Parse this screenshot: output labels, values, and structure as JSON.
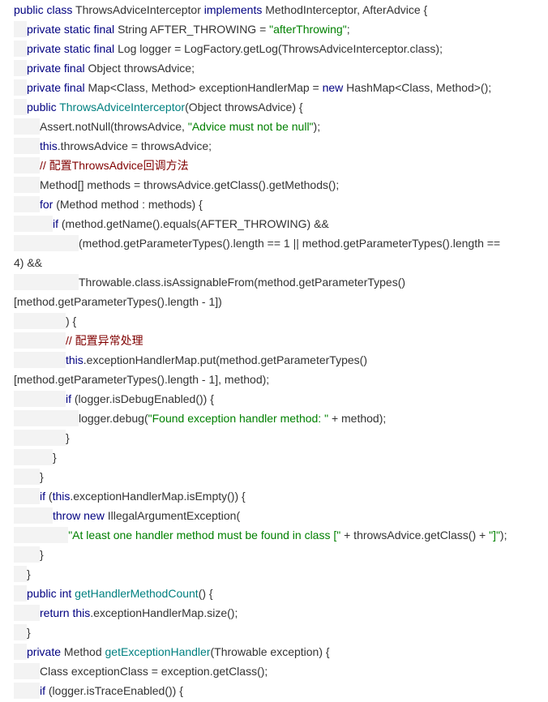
{
  "code": {
    "lines": [
      {
        "indent": 0,
        "tokens": [
          {
            "t": "public class ",
            "c": "kw"
          },
          {
            "t": "ThrowsAdviceInterceptor ",
            "c": "pl"
          },
          {
            "t": "implements ",
            "c": "kw"
          },
          {
            "t": "MethodInterceptor, AfterAdvice {",
            "c": "pl"
          }
        ]
      },
      {
        "indent": 1,
        "tokens": [
          {
            "t": "private static final ",
            "c": "kw"
          },
          {
            "t": "String AFTER_THROWING = ",
            "c": "pl"
          },
          {
            "t": "\"afterThrowing\"",
            "c": "str"
          },
          {
            "t": ";",
            "c": "pl"
          }
        ]
      },
      {
        "indent": 1,
        "tokens": [
          {
            "t": "private static final ",
            "c": "kw"
          },
          {
            "t": "Log logger = LogFactory.getLog(ThrowsAdviceInterceptor.class);",
            "c": "pl"
          }
        ]
      },
      {
        "indent": 1,
        "tokens": [
          {
            "t": "private final ",
            "c": "kw"
          },
          {
            "t": "Object throwsAdvice;",
            "c": "pl"
          }
        ]
      },
      {
        "indent": 1,
        "tokens": [
          {
            "t": "private final ",
            "c": "kw"
          },
          {
            "t": "Map<Class, Method> exceptionHandlerMap = ",
            "c": "pl"
          },
          {
            "t": "new ",
            "c": "kw"
          },
          {
            "t": "HashMap<Class, Method>();",
            "c": "pl"
          }
        ]
      },
      {
        "indent": 1,
        "tokens": [
          {
            "t": "public ",
            "c": "kw"
          },
          {
            "t": "ThrowsAdviceInterceptor",
            "c": "fn"
          },
          {
            "t": "(Object throwsAdvice) {",
            "c": "pl"
          }
        ]
      },
      {
        "indent": 2,
        "tokens": [
          {
            "t": "Assert.notNull(throwsAdvice, ",
            "c": "pl"
          },
          {
            "t": "\"Advice must not be null\"",
            "c": "str"
          },
          {
            "t": ");",
            "c": "pl"
          }
        ]
      },
      {
        "indent": 2,
        "tokens": [
          {
            "t": "this",
            "c": "kw"
          },
          {
            "t": ".throwsAdvice = throwsAdvice;",
            "c": "pl"
          }
        ]
      },
      {
        "indent": 2,
        "tokens": [
          {
            "t": "// 配置ThrowsAdvice回调方法",
            "c": "cmt"
          }
        ]
      },
      {
        "indent": 2,
        "tokens": [
          {
            "t": "Method[] methods = throwsAdvice.getClass().getMethods();",
            "c": "pl"
          }
        ]
      },
      {
        "indent": 2,
        "tokens": [
          {
            "t": "for ",
            "c": "kw"
          },
          {
            "t": "(Method method : methods) {",
            "c": "pl"
          }
        ]
      },
      {
        "indent": 3,
        "tokens": [
          {
            "t": "if ",
            "c": "kw"
          },
          {
            "t": "(method.getName().equals(AFTER_THROWING) &&",
            "c": "pl"
          }
        ]
      },
      {
        "indent": 5,
        "tokens": [
          {
            "t": "(method.getParameterTypes().length == 1 || method.getParameterTypes().length ==",
            "c": "pl"
          }
        ]
      },
      {
        "indent": 0,
        "tokens": [
          {
            "t": "4) &&",
            "c": "pl"
          }
        ]
      },
      {
        "indent": 5,
        "tokens": [
          {
            "t": "Throwable.class.isAssignableFrom(method.getParameterTypes()",
            "c": "pl"
          }
        ]
      },
      {
        "indent": 0,
        "tokens": [
          {
            "t": "[method.getParameterTypes().length - 1])",
            "c": "pl"
          }
        ]
      },
      {
        "indent": 4,
        "tokens": [
          {
            "t": ") {",
            "c": "pl"
          }
        ]
      },
      {
        "indent": 4,
        "tokens": [
          {
            "t": "// 配置异常处理",
            "c": "cmt"
          }
        ]
      },
      {
        "indent": 4,
        "tokens": [
          {
            "t": "this",
            "c": "kw"
          },
          {
            "t": ".exceptionHandlerMap.put(method.getParameterTypes()",
            "c": "pl"
          }
        ]
      },
      {
        "indent": 0,
        "tokens": [
          {
            "t": "[method.getParameterTypes().length - 1], method);",
            "c": "pl"
          }
        ]
      },
      {
        "indent": 4,
        "tokens": [
          {
            "t": "if ",
            "c": "kw"
          },
          {
            "t": "(logger.isDebugEnabled()) {",
            "c": "pl"
          }
        ]
      },
      {
        "indent": 5,
        "tokens": [
          {
            "t": "logger.debug(",
            "c": "pl"
          },
          {
            "t": "\"Found exception handler method: \"",
            "c": "str"
          },
          {
            "t": " + method);",
            "c": "pl"
          }
        ]
      },
      {
        "indent": 4,
        "tokens": [
          {
            "t": "}",
            "c": "pl"
          }
        ]
      },
      {
        "indent": 3,
        "tokens": [
          {
            "t": "}",
            "c": "pl"
          }
        ]
      },
      {
        "indent": 2,
        "tokens": [
          {
            "t": "}",
            "c": "pl"
          }
        ]
      },
      {
        "indent": 2,
        "tokens": [
          {
            "t": "if ",
            "c": "kw"
          },
          {
            "t": "(",
            "c": "pl"
          },
          {
            "t": "this",
            "c": "kw"
          },
          {
            "t": ".exceptionHandlerMap.isEmpty()) {",
            "c": "pl"
          }
        ]
      },
      {
        "indent": 3,
        "tokens": [
          {
            "t": "throw new ",
            "c": "kw"
          },
          {
            "t": "IllegalArgumentException(",
            "c": "pl"
          }
        ]
      },
      {
        "indent": 4.2,
        "tokens": [
          {
            "t": "\"At least one handler method must be found in class [\"",
            "c": "str"
          },
          {
            "t": " + throwsAdvice.getClass() + ",
            "c": "pl"
          },
          {
            "t": "\"]\"",
            "c": "str"
          },
          {
            "t": ");",
            "c": "pl"
          }
        ]
      },
      {
        "indent": 2,
        "tokens": [
          {
            "t": "}",
            "c": "pl"
          }
        ]
      },
      {
        "indent": 1,
        "tokens": [
          {
            "t": "}",
            "c": "pl"
          }
        ]
      },
      {
        "indent": 1,
        "tokens": [
          {
            "t": "public int ",
            "c": "kw"
          },
          {
            "t": "getHandlerMethodCount",
            "c": "fn"
          },
          {
            "t": "() {",
            "c": "pl"
          }
        ]
      },
      {
        "indent": 2,
        "tokens": [
          {
            "t": "return this",
            "c": "kw"
          },
          {
            "t": ".exceptionHandlerMap.size();",
            "c": "pl"
          }
        ]
      },
      {
        "indent": 1,
        "tokens": [
          {
            "t": "}",
            "c": "pl"
          }
        ]
      },
      {
        "indent": 1,
        "tokens": [
          {
            "t": "private ",
            "c": "kw"
          },
          {
            "t": "Method ",
            "c": "pl"
          },
          {
            "t": "getExceptionHandler",
            "c": "fn"
          },
          {
            "t": "(Throwable exception) {",
            "c": "pl"
          }
        ]
      },
      {
        "indent": 2,
        "tokens": [
          {
            "t": "Class exceptionClass = exception.getClass();",
            "c": "pl"
          }
        ]
      },
      {
        "indent": 2,
        "tokens": [
          {
            "t": "if ",
            "c": "kw"
          },
          {
            "t": "(logger.isTraceEnabled()) {",
            "c": "pl"
          }
        ]
      }
    ]
  },
  "colors": {
    "keyword": "#000080",
    "string": "#008000",
    "comment": "#800000",
    "function": "#008080",
    "plain": "#333333",
    "indent_guide": "#f3f3f3"
  }
}
